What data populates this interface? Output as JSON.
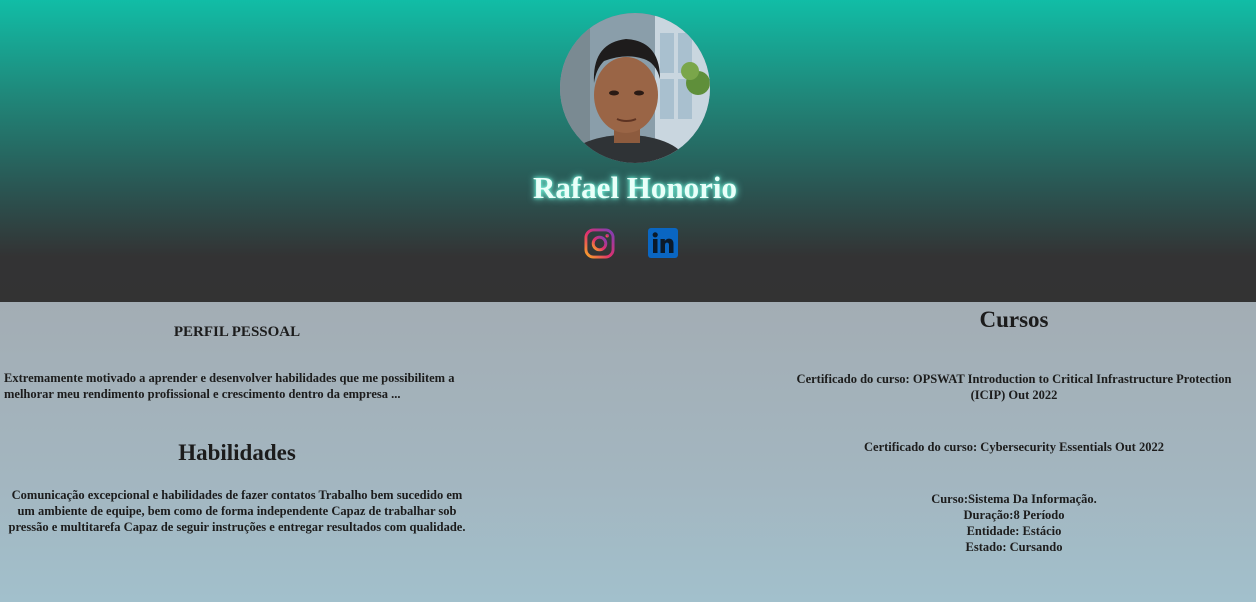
{
  "profile": {
    "name": "Rafael Honorio",
    "social": [
      {
        "icon": "instagram-icon"
      },
      {
        "icon": "linkedin-icon"
      }
    ]
  },
  "perfil": {
    "title": "PERFIL PESSOAL",
    "text": "Extremamente motivado a aprender e desenvolver habilidades que me possibilitem a melhorar meu rendimento profissional e crescimento dentro da empresa ..."
  },
  "habilidades": {
    "title": "Habilidades",
    "text": "Comunicação excepcional e habilidades de fazer contatos Trabalho bem sucedido em um ambiente de equipe, bem como de forma independente Capaz de trabalhar sob pressão e multitarefa Capaz de seguir instruções e entregar resultados com qualidade."
  },
  "cursos": {
    "title": "Cursos",
    "cert1": "Certificado do curso: OPSWAT Introduction to Critical Infrastructure Protection (ICIP) Out 2022",
    "cert2": "Certificado do curso: Cybersecurity Essentials Out 2022",
    "curso_lines": [
      "Curso:Sistema Da Informação.",
      "Duração:8 Período",
      "Entidade: Estácio",
      "Estado: Cursando"
    ]
  },
  "colors": {
    "header_top": "#11bda6",
    "header_bottom": "#333333",
    "content_bg": "#a3b6c0",
    "linkedin": "#0a66c2"
  }
}
